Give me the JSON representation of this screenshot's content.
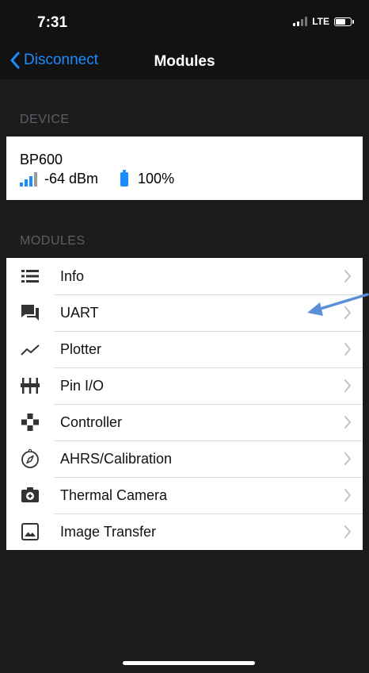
{
  "status_bar": {
    "time": "7:31",
    "network": "LTE"
  },
  "nav": {
    "back_label": "Disconnect",
    "title": "Modules"
  },
  "device_section": {
    "header": "DEVICE",
    "device": {
      "name": "BP600",
      "rssi": "-64 dBm",
      "battery": "100%"
    }
  },
  "modules_section": {
    "header": "MODULES",
    "items": [
      {
        "label": "Info",
        "icon": "list-icon"
      },
      {
        "label": "UART",
        "icon": "chat-icon"
      },
      {
        "label": "Plotter",
        "icon": "chart-line-icon"
      },
      {
        "label": "Pin I/O",
        "icon": "pins-icon"
      },
      {
        "label": "Controller",
        "icon": "gamepad-icon"
      },
      {
        "label": "AHRS/Calibration",
        "icon": "compass-icon"
      },
      {
        "label": "Thermal Camera",
        "icon": "camera-icon"
      },
      {
        "label": "Image Transfer",
        "icon": "image-icon"
      }
    ]
  },
  "colors": {
    "accent": "#1a8cff",
    "background": "#1c1c1e",
    "annotation_arrow": "#5b8fd6"
  }
}
